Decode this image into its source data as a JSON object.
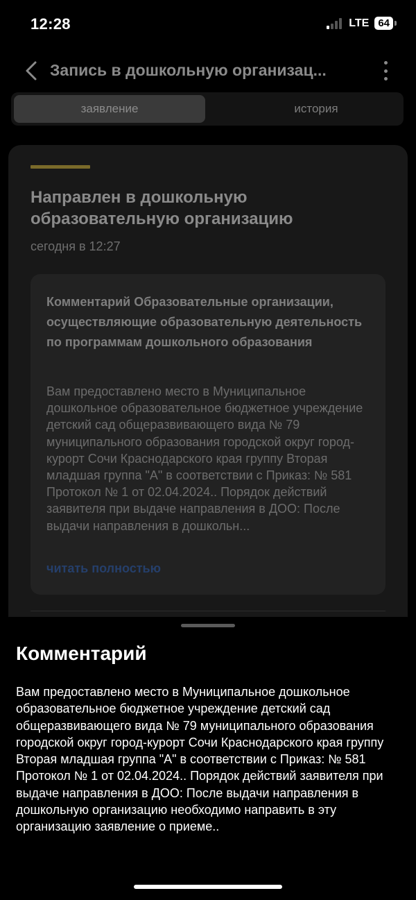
{
  "status_bar": {
    "time": "12:28",
    "network": "LTE",
    "battery": "64"
  },
  "nav": {
    "title": "Запись в дошкольную организац..."
  },
  "tabs": [
    {
      "label": "заявление",
      "active": true
    },
    {
      "label": "история",
      "active": false
    }
  ],
  "card": {
    "accent_color": "#7a6a2a",
    "status_title": "Направлен в дошкольную образовательную организацию",
    "timestamp": "сегодня в 12:27",
    "comment": {
      "heading": "Комментарий Образовательные организации, осуществляющие образовательную деятельность по программам дошкольного образования",
      "body": "Вам предоставлено место в Муниципальное дошкольное образовательное бюджетное учреждение детский сад общеразвивающего вида № 79 муниципального образования городской округ город-курорт Сочи Краснодарского края группу Вторая младшая группа \"А\" в соответствии с Приказ: № 581 Протокол № 1 от 02.04.2024.. Порядок действий заявителя при выдаче направления в ДОО: После выдачи направления в дошкольн...",
      "read_more": "читать полностью"
    }
  },
  "sheet": {
    "title": "Комментарий",
    "text": "Вам предоставлено место в Муниципальное дошкольное образовательное бюджетное учреждение детский сад общеразвивающего вида № 79 муниципального образования городской округ город-курорт Сочи Краснодарского края группу Вторая младшая группа \"А\" в соответствии с Приказ: № 581 Протокол № 1 от 02.04.2024.. Порядок действий заявителя при выдаче направления в ДОО: После выдачи направления в дошкольную организацию необходимо направить в эту организацию заявление о приеме.."
  }
}
